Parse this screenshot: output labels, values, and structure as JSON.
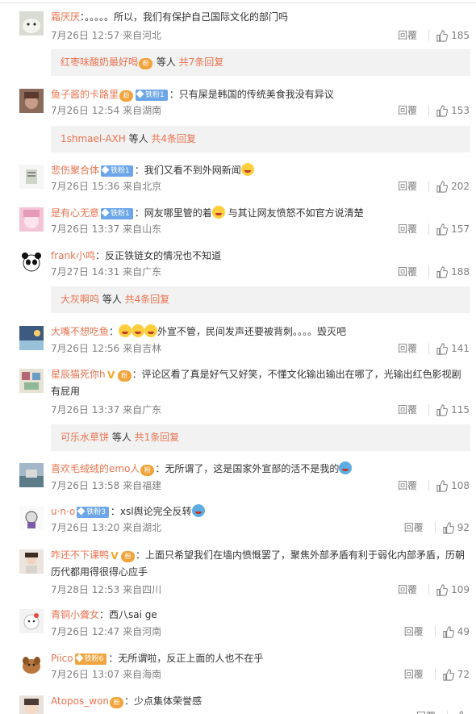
{
  "comments": [
    {
      "user": "霜厌厌",
      "text": "：。。。。。所以，我们有保护自己国际文化的部门吗",
      "time": "7月26日 12:57",
      "location": "来自河北",
      "reply_label": "回覆",
      "likes": "185",
      "replies": {
        "name": "红枣味酸奶最好喝",
        "mid": " 等人 ",
        "count": "共7条回复"
      }
    },
    {
      "user": "鱼子酱的卡路里",
      "badge": "铁粉1",
      "text": "：只有屎是韩国的传统美食我没有异议",
      "time": "7月26日 12:54",
      "location": "来自湖南",
      "reply_label": "回覆",
      "likes": "153",
      "replies": {
        "name": "1shmael-AXH",
        "mid": " 等人 ",
        "count": "共4条回复"
      }
    },
    {
      "user": "悲伤聚合体",
      "badge": "铁粉1",
      "text": "：我们又看不到外网新闻",
      "time": "7月26日 15:36",
      "location": "来自北京",
      "reply_label": "回覆",
      "likes": "202"
    },
    {
      "user": "是有心无意",
      "badge": "铁粉1",
      "text": "：网友哪里管的着",
      "text2": " 与其让网友愤怒不如官方说清楚",
      "time": "7月26日 13:37",
      "location": "来自山东",
      "reply_label": "回覆",
      "likes": "157"
    },
    {
      "user": "frank小鸣",
      "text": "：反正铁链女的情况也不知道",
      "time": "7月27日 14:31",
      "location": "来自广东",
      "reply_label": "回覆",
      "likes": "188",
      "replies": {
        "name": "大灰啊呜",
        "mid": " 等人 ",
        "count": "共4条回复"
      }
    },
    {
      "user": "大嘴不想吃鱼",
      "text": "：",
      "text2": "外宣不管，民间发声还要被背刺。。。。毁灭吧",
      "time": "7月26日 12:56",
      "location": "来自吉林",
      "reply_label": "回覆",
      "likes": "141"
    },
    {
      "user": "星辰猫死你h",
      "text": "：评论区看了真是好气又好笑，不懂文化输出输出在哪了，光输出红色影视剧",
      "text_line2": "有屁用",
      "time": "7月26日 13:37",
      "location": "来自广东",
      "reply_label": "回覆",
      "likes": "115",
      "replies": {
        "name": "可乐水草饼",
        "mid": " 等人 ",
        "count": "共1条回复"
      }
    },
    {
      "user": "喜欢毛绒绒的emo人",
      "text": "：无所谓了，这是国家外宣部的活不是我的",
      "time": "7月26日 13:58",
      "location": "来自福建",
      "reply_label": "回覆",
      "likes": "108"
    },
    {
      "user": "u·n·o",
      "badge": "铁粉3",
      "text": "：xsl舆论完全反转",
      "time": "7月26日 13:20",
      "location": "来自湖北",
      "reply_label": "回覆",
      "likes": "92"
    },
    {
      "user": "咋还不下课鸭",
      "text": "：上面只希望我们在墙内愤慨罢了，聚焦外部矛盾有利于弱化内部矛盾，历朝",
      "text_line2": "历代都用得很得心应手",
      "time": "7月28日 12:53",
      "location": "来自四川",
      "reply_label": "回覆",
      "likes": "109"
    },
    {
      "user": "青铜小聋女",
      "text": "：西八sai ge",
      "time": "7月26日 12:47",
      "location": "来自河南",
      "reply_label": "回覆",
      "likes": "49"
    },
    {
      "user": "Piico",
      "badge": "铁粉6",
      "text": "：无所谓啦，反正上面的人也不在乎",
      "time": "7月26日 13:07",
      "location": "来自海南",
      "reply_label": "回覆",
      "likes": "72"
    },
    {
      "user": "Atopos_won",
      "text": "：少点集体荣誉感",
      "reply_label": "回覆"
    }
  ]
}
